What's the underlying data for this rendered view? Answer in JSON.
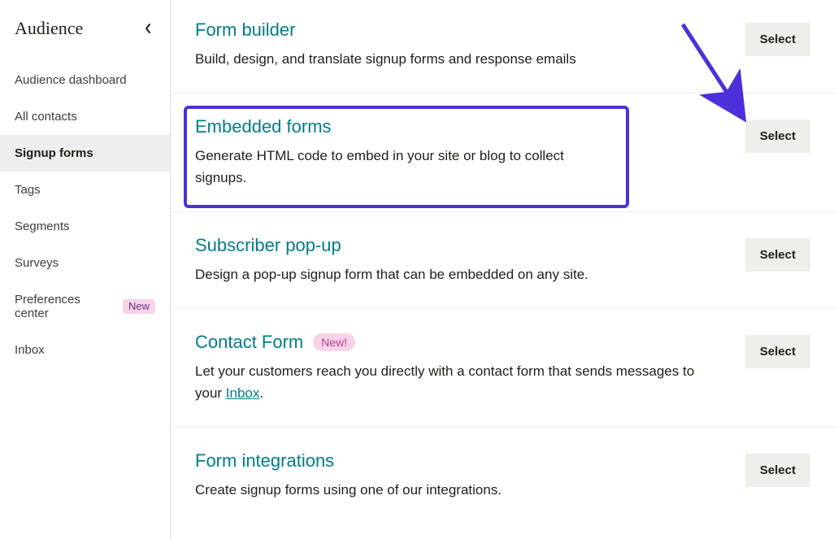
{
  "sidebar": {
    "title": "Audience",
    "items": [
      {
        "label": "Audience dashboard"
      },
      {
        "label": "All contacts"
      },
      {
        "label": "Signup forms"
      },
      {
        "label": "Tags"
      },
      {
        "label": "Segments"
      },
      {
        "label": "Surveys"
      },
      {
        "label": "Preferences center",
        "badge": "New"
      },
      {
        "label": "Inbox"
      }
    ]
  },
  "forms": {
    "select_label": "Select",
    "builder": {
      "title": "Form builder",
      "desc": "Build, design, and translate signup forms and response emails"
    },
    "embedded": {
      "title": "Embedded forms",
      "desc": "Generate HTML code to embed in your site or blog to collect signups."
    },
    "popup": {
      "title": "Subscriber pop-up",
      "desc": "Design a pop-up signup form that can be embedded on any site."
    },
    "contact": {
      "title": "Contact Form",
      "badge": "New!",
      "desc_a": "Let your customers reach you directly with a contact form that sends messages to your ",
      "desc_link": "Inbox",
      "desc_b": "."
    },
    "integrations": {
      "title": "Form integrations",
      "desc": "Create signup forms using one of our integrations."
    }
  }
}
